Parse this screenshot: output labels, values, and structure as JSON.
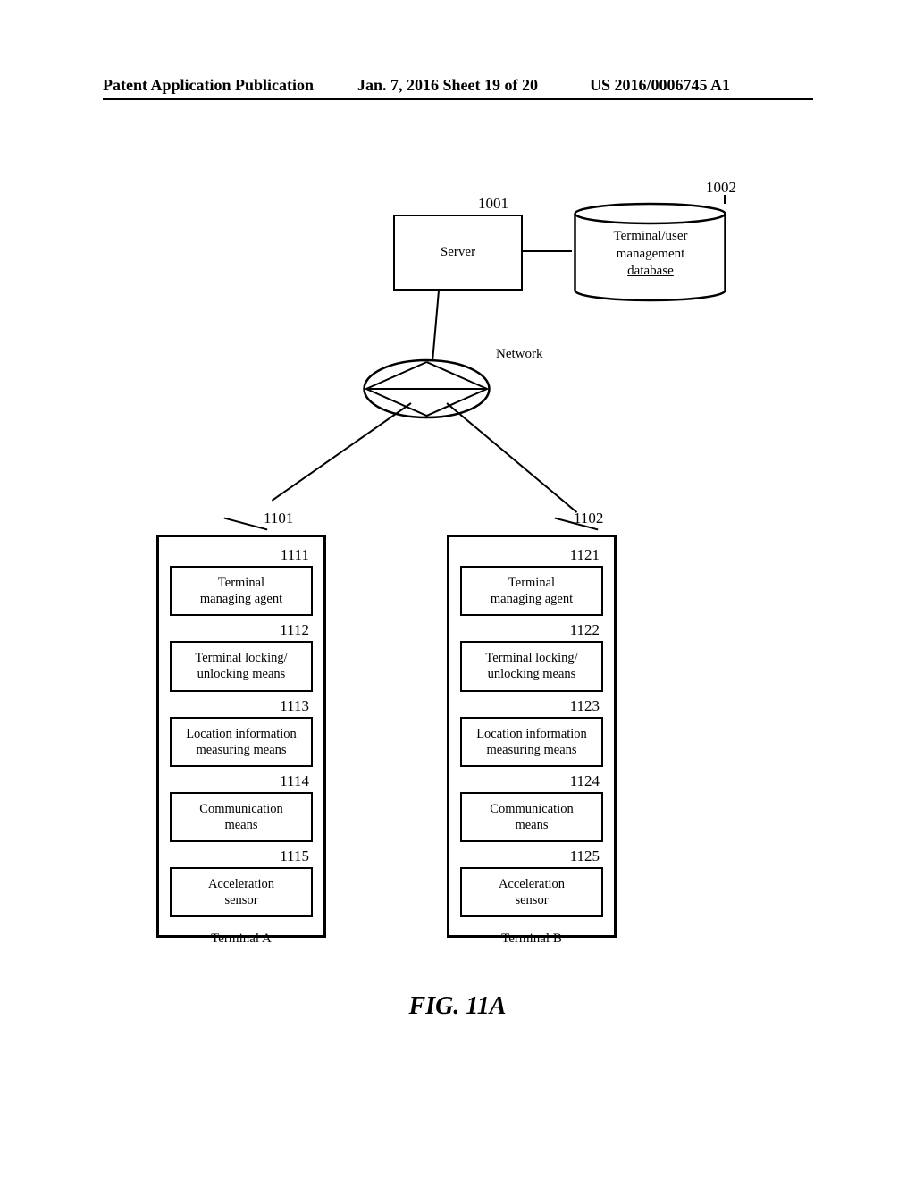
{
  "header": {
    "left": "Patent Application Publication",
    "center": "Jan. 7, 2016  Sheet 19 of 20",
    "right": "US 2016/0006745 A1"
  },
  "server": {
    "label": "Server",
    "ref": "1001"
  },
  "database": {
    "line1": "Terminal/user",
    "line2": "management",
    "line3": "database",
    "ref": "1002"
  },
  "network": {
    "label": "Network"
  },
  "terminalA": {
    "ref": "1101",
    "label": "Terminal A",
    "components": [
      {
        "ref": "1111",
        "line1": "Terminal",
        "line2": "managing agent"
      },
      {
        "ref": "1112",
        "line1": "Terminal locking/",
        "line2": "unlocking means"
      },
      {
        "ref": "1113",
        "line1": "Location information",
        "line2": "measuring means"
      },
      {
        "ref": "1114",
        "line1": "Communication",
        "line2": "means"
      },
      {
        "ref": "1115",
        "line1": "Acceleration",
        "line2": "sensor"
      }
    ]
  },
  "terminalB": {
    "ref": "1102",
    "label": "Terminal B",
    "components": [
      {
        "ref": "1121",
        "line1": "Terminal",
        "line2": "managing agent"
      },
      {
        "ref": "1122",
        "line1": "Terminal locking/",
        "line2": "unlocking means"
      },
      {
        "ref": "1123",
        "line1": "Location information",
        "line2": "measuring means"
      },
      {
        "ref": "1124",
        "line1": "Communication",
        "line2": "means"
      },
      {
        "ref": "1125",
        "line1": "Acceleration",
        "line2": "sensor"
      }
    ]
  },
  "figure": {
    "title": "FIG. 11A"
  }
}
